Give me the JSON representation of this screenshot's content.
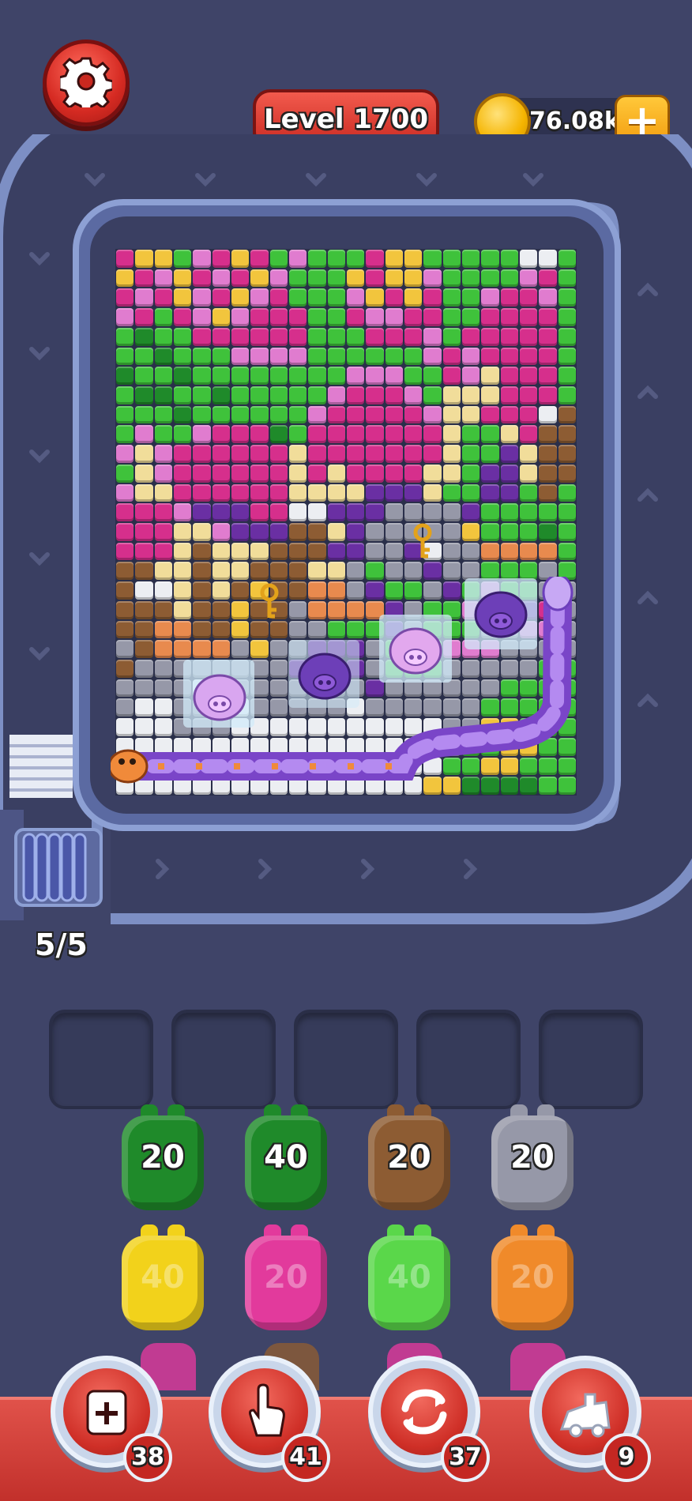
{
  "header": {
    "level_label": "Level 1700",
    "coins": "76.08k",
    "add_coins_icon": "plus-icon",
    "settings_icon": "gear-icon"
  },
  "progress": {
    "text": "5/5"
  },
  "board": {
    "palette": {
      "G": "#3fc23b",
      "D": "#1f8a2a",
      "P": "#d62f8c",
      "L": "#e07ccf",
      "Y": "#f2c53d",
      "C": "#f1dd9a",
      "B": "#8d5c33",
      "V": "#6a2fa3",
      "S": "#9698a8",
      "W": "#eceef2",
      "O": "#e88a4e",
      "K": "#232733"
    },
    "rows": [
      "PYYGLPYPGLGGGPYYGGGGGWWG",
      "YPLYPLPYLGGGYPYYLGGGGLPG",
      "PLPYLPYLPGGGLYPYPGGLPPLG",
      "LPGPLYLPPPGGPLLPPGGPPPPG",
      "GDGGPPPPPPGGGPPPLGPPPPPG",
      "GGDGGGLLLLGGGGGGLPLPPPPG",
      "DGGDGGGGGGGGLLLGGPLCPPPG",
      "GDDGGDGGGGGLPPPLGCCCPPPG",
      "GGGDGGGGGGLPPPPPLCCPPPWB",
      "GLGGLPPPDGPPPPPPPCGGCPBB",
      "LCLPPPPPPCPPPPPPPCGGVCBB",
      "GCLPPPPPPCPCPPPPCCGVVCBB",
      "LCCPPPPPPCCCCVVVCGGVVGBG",
      "PPPLVVVPPWWVVVSSSSVGGGGG",
      "PPPCCLVVVBBCVSSSSSYGGGDG",
      "PPPCBCCCBBBVVSSVWSSOOOOG",
      "BBCCBCCBBBCCSGSSVSSGGGSG",
      "BWWCBCBYBBOOSVGGSVGLGGSS",
      "BBBCBBYBBSOOOOVSGGLLGVPS",
      "BBOOBBYBBSSGGGVSGGGSSLLS",
      "SBOOOOSYSSVVVSGGGLLLSSSS",
      "BSSSSSSSSVVVVSGGGSSSSSGG",
      "SSSSWWSSSSSSSVSSSSSSGGGG",
      "SWWSSSWSSSSSWSSSSSSGGGGG",
      "WWWSSSWWWWWWWWWWWSSYYGGG",
      "WWWWWWWWWWWWWWWWSSGGYYGG",
      "WWWWWWWWWWWWWWWWWGGYYGGG",
      "WWWWWWWWWWWWWWWWYYDDDDGG"
    ]
  },
  "slots": [
    "",
    "",
    "",
    "",
    ""
  ],
  "shooters": [
    {
      "count": "20",
      "color": "#1f8a2a"
    },
    {
      "count": "40",
      "color": "#1f8a2a"
    },
    {
      "count": "20",
      "color": "#8d5c33"
    },
    {
      "count": "20",
      "color": "#9698a8"
    },
    {
      "count": "40",
      "color": "#f2d21b"
    },
    {
      "count": "20",
      "color": "#e23a9c"
    },
    {
      "count": "40",
      "color": "#5ad74a"
    },
    {
      "count": "20",
      "color": "#f08a2a"
    }
  ],
  "boosters": [
    {
      "icon": "add-slot-icon",
      "count": "38"
    },
    {
      "icon": "tap-hand-icon",
      "count": "41"
    },
    {
      "icon": "shuffle-icon",
      "count": "37"
    },
    {
      "icon": "train-icon",
      "count": "9"
    }
  ]
}
